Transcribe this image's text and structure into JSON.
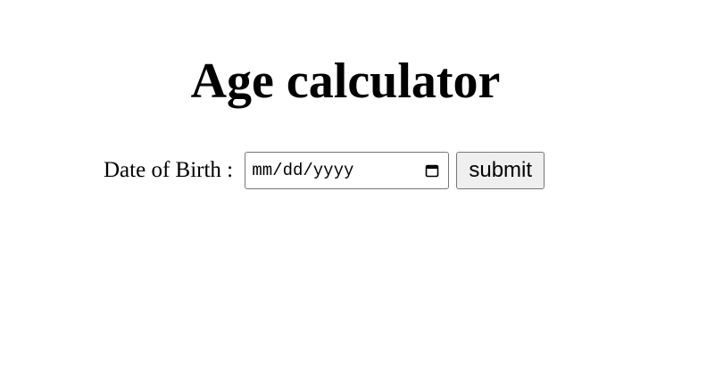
{
  "header": {
    "title": "Age calculator"
  },
  "form": {
    "dob_label": "Date of Birth : ",
    "date_input": {
      "placeholder": "mm/dd/yyyy",
      "value": "",
      "icon": "calendar-icon"
    },
    "submit_label": "submit"
  }
}
